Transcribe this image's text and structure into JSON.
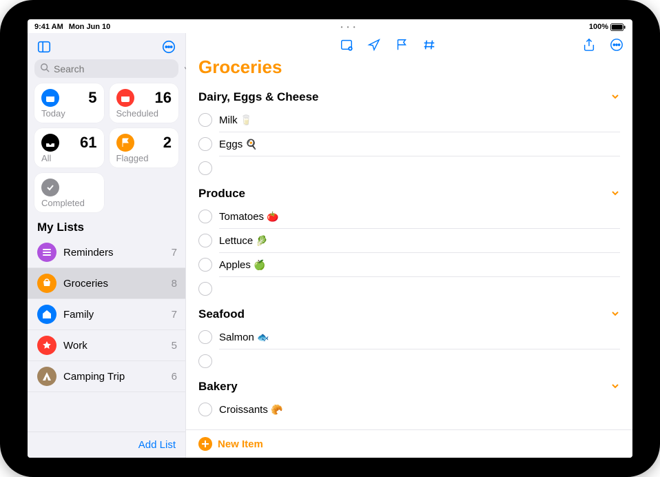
{
  "status": {
    "time": "9:41 AM",
    "date": "Mon Jun 10",
    "battery": "100%"
  },
  "sidebar": {
    "search_placeholder": "Search",
    "smart": {
      "today": {
        "label": "Today",
        "count": "5"
      },
      "scheduled": {
        "label": "Scheduled",
        "count": "16"
      },
      "all": {
        "label": "All",
        "count": "61"
      },
      "flagged": {
        "label": "Flagged",
        "count": "2"
      },
      "completed": {
        "label": "Completed"
      }
    },
    "my_lists_title": "My Lists",
    "lists": [
      {
        "name": "Reminders",
        "count": "7",
        "color": "#af52de"
      },
      {
        "name": "Groceries",
        "count": "8",
        "color": "#ff9500"
      },
      {
        "name": "Family",
        "count": "7",
        "color": "#007aff"
      },
      {
        "name": "Work",
        "count": "5",
        "color": "#ff3b30"
      },
      {
        "name": "Camping Trip",
        "count": "6",
        "color": "#a2845e"
      }
    ],
    "add_list": "Add List"
  },
  "content": {
    "title": "Groceries",
    "new_item": "New Item",
    "sections": [
      {
        "title": "Dairy, Eggs & Cheese",
        "items": [
          {
            "text": "Milk",
            "emoji": "🥛"
          },
          {
            "text": "Eggs",
            "emoji": "🍳"
          }
        ],
        "has_empty": true
      },
      {
        "title": "Produce",
        "items": [
          {
            "text": "Tomatoes",
            "emoji": "🍅"
          },
          {
            "text": "Lettuce",
            "emoji": "🥬"
          },
          {
            "text": "Apples",
            "emoji": "🍏"
          }
        ],
        "has_empty": true
      },
      {
        "title": "Seafood",
        "items": [
          {
            "text": "Salmon",
            "emoji": "🐟"
          }
        ],
        "has_empty": true
      },
      {
        "title": "Bakery",
        "items": [
          {
            "text": "Croissants",
            "emoji": "🥐"
          }
        ],
        "has_empty": false
      }
    ]
  }
}
